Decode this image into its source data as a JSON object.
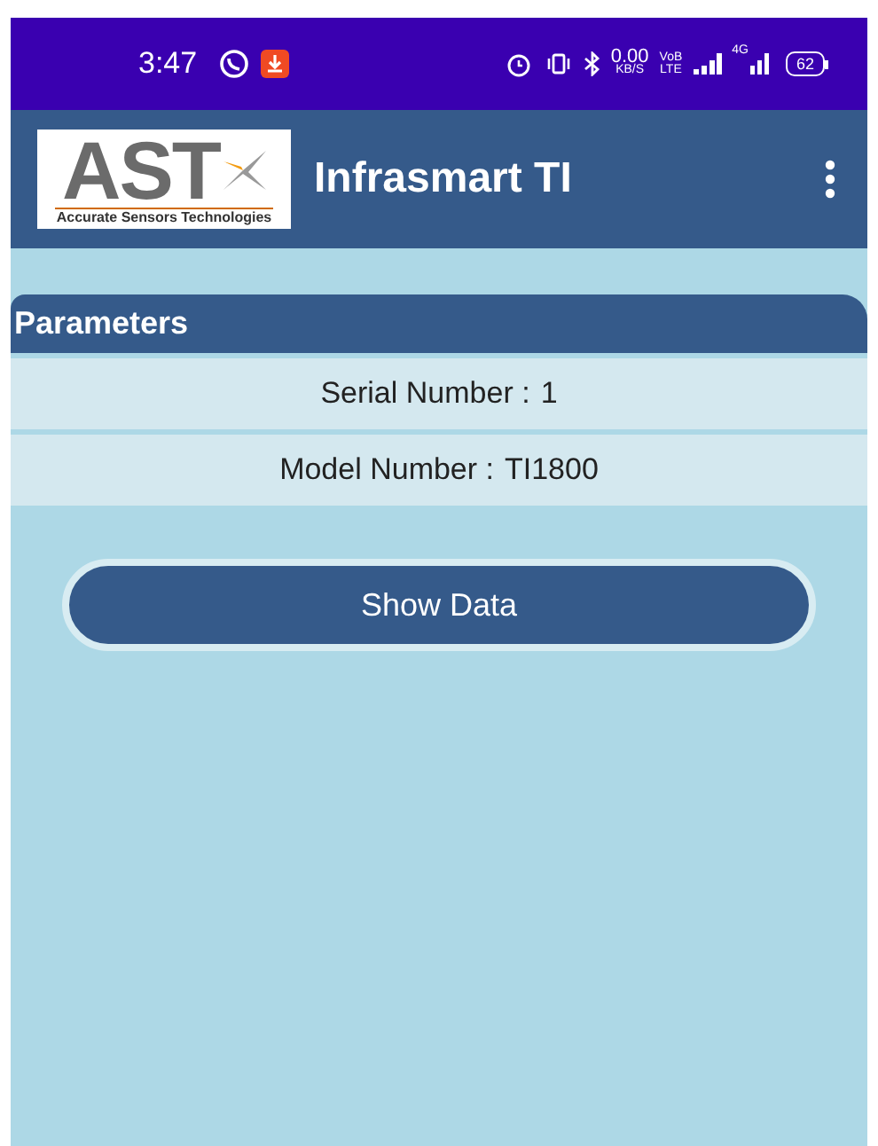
{
  "status_bar": {
    "time": "3:47",
    "net_speed": "0.00",
    "net_speed_unit": "KB/S",
    "volte_top": "VoB",
    "volte_bottom": "LTE",
    "network_type": "4G",
    "battery": "62"
  },
  "app_bar": {
    "logo_text": "AST",
    "logo_caption": "Accurate Sensors Technologies",
    "title": "Infrasmart TI"
  },
  "parameters": {
    "heading": "Parameters",
    "rows": [
      {
        "label": "Serial Number :",
        "value": "1"
      },
      {
        "label": "Model Number :",
        "value": "TI1800"
      }
    ]
  },
  "button": "Show Data"
}
